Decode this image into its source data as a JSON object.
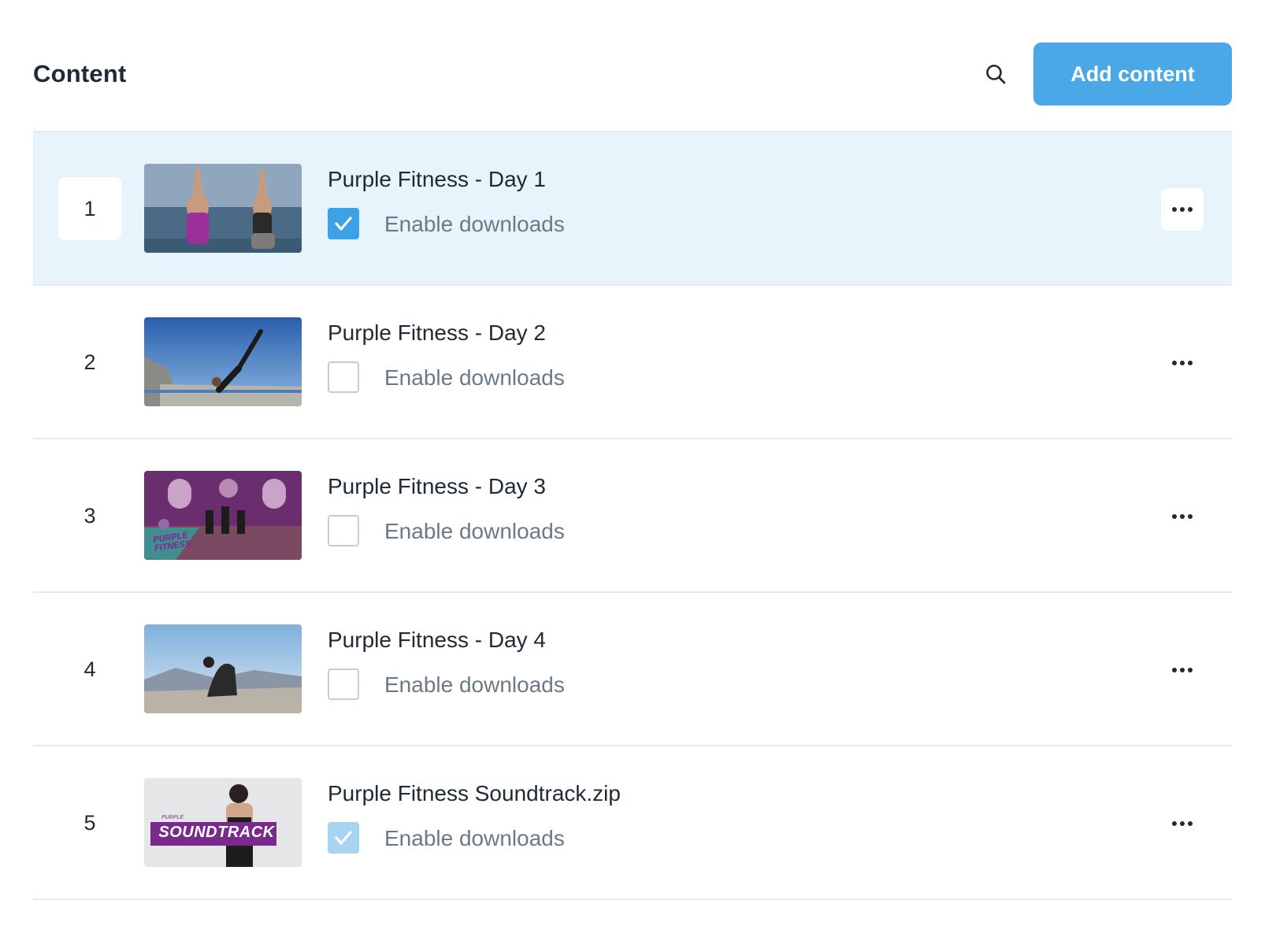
{
  "header": {
    "title": "Content",
    "search_icon": "search-icon",
    "add_button_label": "Add content"
  },
  "colors": {
    "primary": "#4aa8e6",
    "selected_row_bg": "#e8f4fb",
    "checkbox_checked": "#3aa2e5",
    "checkbox_checked_muted": "#a8d4f2"
  },
  "items": [
    {
      "index": "1",
      "title": "Purple Fitness - Day 1",
      "checkbox_label": "Enable downloads",
      "downloads_enabled": true,
      "selected": true,
      "thumbnail": "yoga-two-women-sea-thumbnail"
    },
    {
      "index": "2",
      "title": "Purple Fitness - Day 2",
      "checkbox_label": "Enable downloads",
      "downloads_enabled": false,
      "selected": false,
      "thumbnail": "yoga-pose-cliff-thumbnail"
    },
    {
      "index": "3",
      "title": "Purple Fitness - Day 3",
      "checkbox_label": "Enable downloads",
      "downloads_enabled": false,
      "selected": false,
      "thumbnail": "purple-fitness-studio-thumbnail",
      "thumbnail_text": "PURPLE FITNESS"
    },
    {
      "index": "4",
      "title": "Purple Fitness - Day 4",
      "checkbox_label": "Enable downloads",
      "downloads_enabled": false,
      "selected": false,
      "thumbnail": "yoga-backbend-mountains-thumbnail"
    },
    {
      "index": "5",
      "title": "Purple Fitness Soundtrack.zip",
      "checkbox_label": "Enable downloads",
      "downloads_enabled": true,
      "selected": false,
      "thumbnail": "soundtrack-thumbnail",
      "thumbnail_text": "SOUNDTRACK"
    }
  ]
}
